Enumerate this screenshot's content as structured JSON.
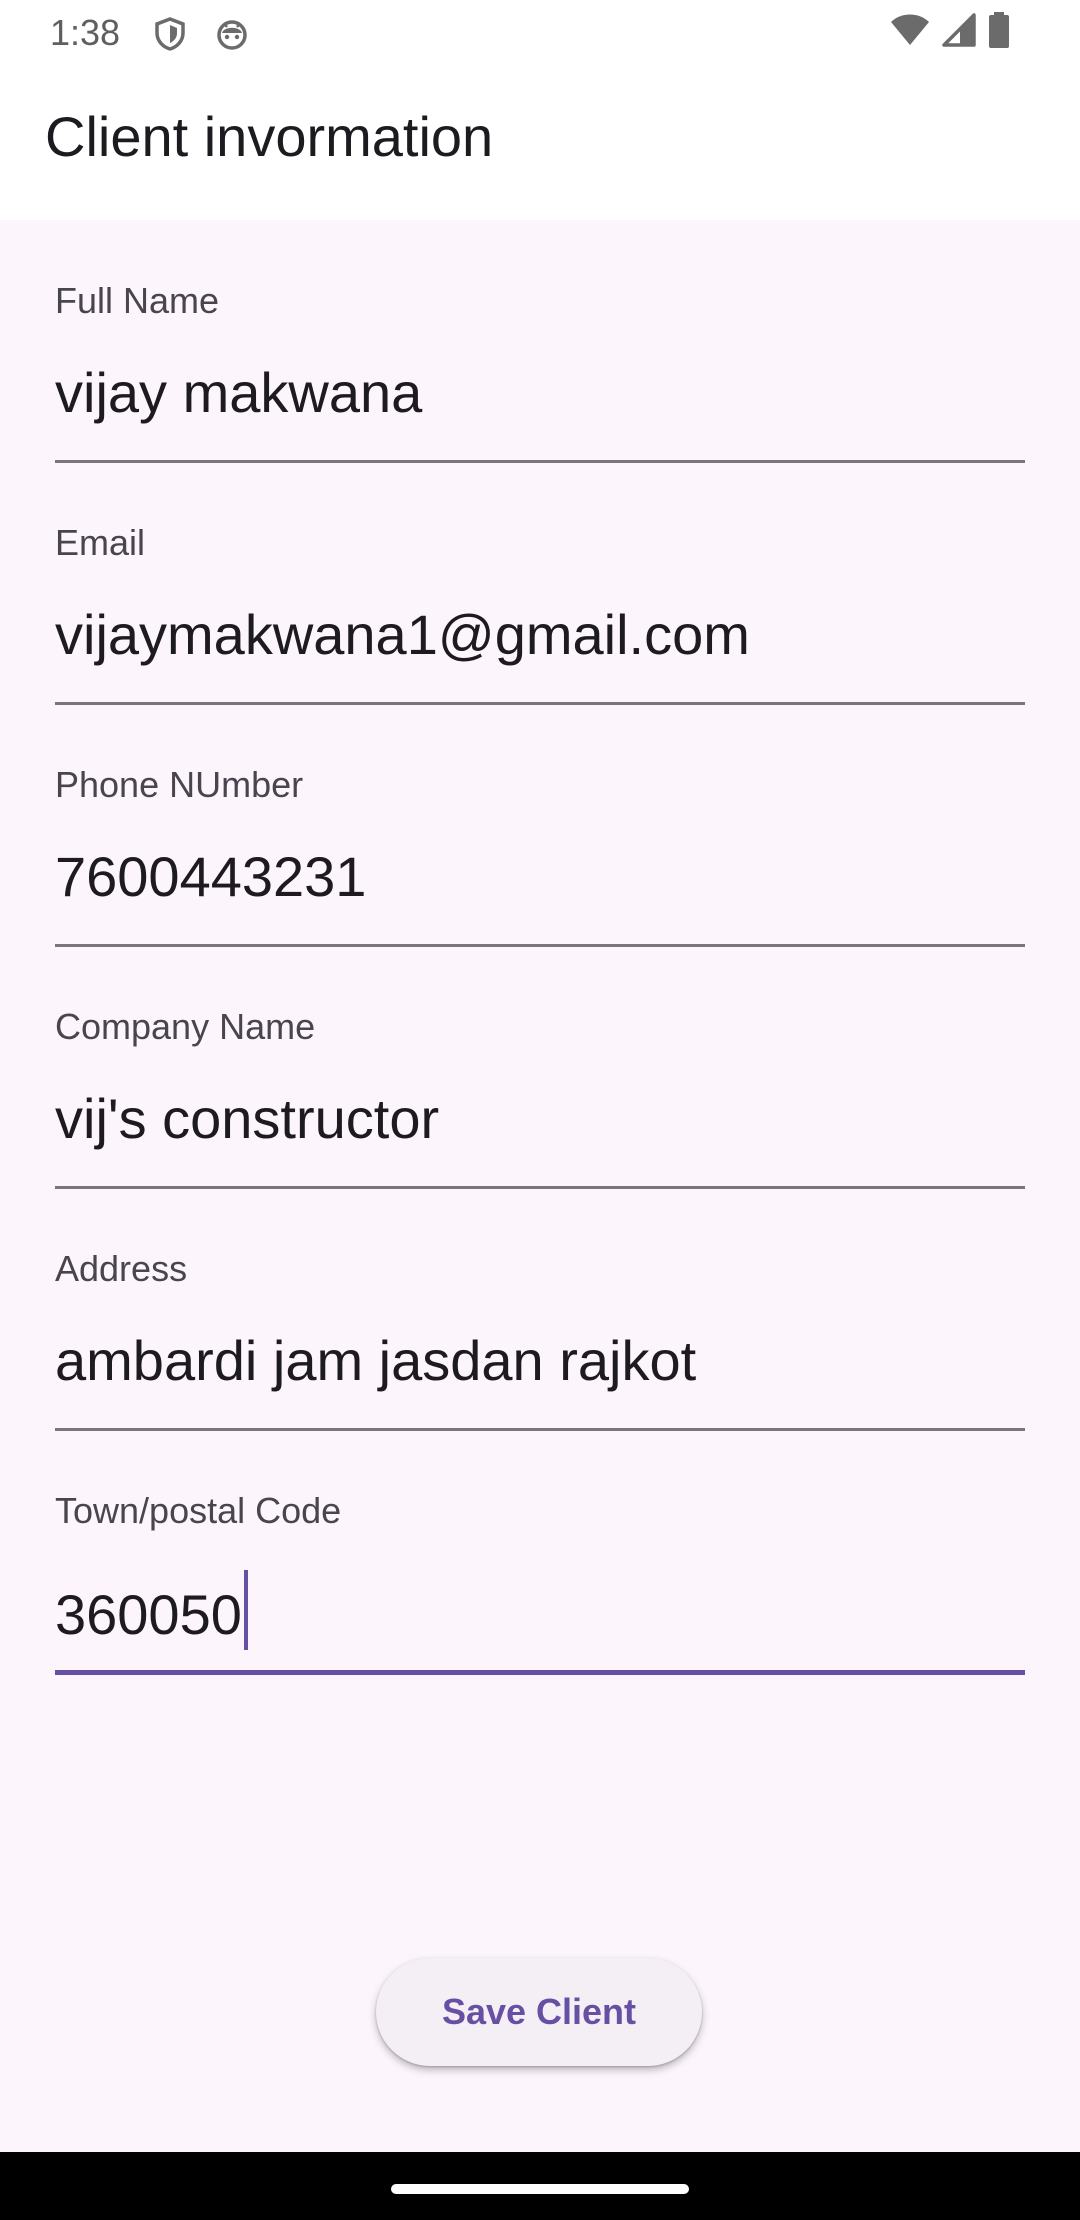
{
  "status_bar": {
    "time": "1:38",
    "left_icons": [
      "shield-icon",
      "android-icon"
    ],
    "right_icons": [
      "wifi-icon",
      "cellular-signal-icon",
      "battery-icon"
    ]
  },
  "app_bar": {
    "title": "Client invormation"
  },
  "form": {
    "fields": [
      {
        "label": "Full Name",
        "value": "vijay makwana"
      },
      {
        "label": "Email",
        "value": "vijaymakwana1@gmail.com"
      },
      {
        "label": "Phone NUmber",
        "value": "7600443231"
      },
      {
        "label": "Company Name",
        "value": "vij's constructor"
      },
      {
        "label": "Address",
        "value": "ambardi jam jasdan rajkot"
      },
      {
        "label": "Town/postal Code",
        "value": "360050"
      }
    ],
    "save_label": "Save Client"
  },
  "colors": {
    "accent": "#6750a4",
    "surface": "#fcf5fc",
    "underline": "#79747e"
  }
}
